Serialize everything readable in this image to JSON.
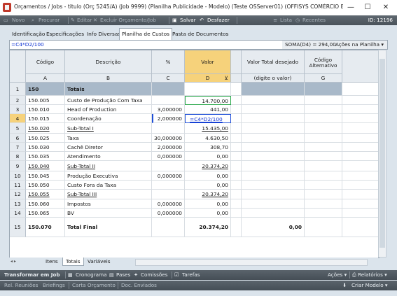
{
  "window": {
    "title": "Orçamentos / Jobs - titulo (Orç 5245/A) (Job 9999) (Planilha Publicidade - Modelo) (Teste OSServer01) (OFFISYS COMÉRCIO E SERVIÇO...",
    "minimize": "—",
    "maximize": "☐",
    "close": "✕"
  },
  "toolbar": {
    "novo": "Novo",
    "procurar": "Procurar",
    "editar": "Editar",
    "excluir": "Excluir Orçamento/Job",
    "salvar": "Salvar",
    "desfazer": "Desfazer",
    "lista": "Lista",
    "recentes": "Recentes",
    "id": "ID: 12196"
  },
  "tabs": [
    "Identificação",
    "Especificações",
    "Info Diversas",
    "Planilha de Custos",
    "Pasta de Documentos"
  ],
  "active_tab": 3,
  "formula_bar": {
    "formula": "=C4*D2/100",
    "sum": "SOMA(D4) = 294,00",
    "actions": "Ações na Planilha"
  },
  "columns": {
    "headers": [
      "Código",
      "Descrição",
      "%",
      "Valor",
      "Valor Total desejado",
      "Código Alternativo"
    ],
    "letters": [
      "A",
      "B",
      "C",
      "D",
      "(digite o valor)",
      "G"
    ]
  },
  "rows": [
    {
      "n": "1",
      "code": "150",
      "desc": "Totais",
      "pct": "",
      "valor": "",
      "total": "",
      "style": "band"
    },
    {
      "n": "2",
      "code": "150.005",
      "desc": "Custo de Produção Com Taxa",
      "pct": "",
      "valor": "14.700,00",
      "total": "",
      "style": ""
    },
    {
      "n": "3",
      "code": "150.010",
      "desc": "Head of Production",
      "pct": "3,000000",
      "valor": "441,00",
      "total": "",
      "style": ""
    },
    {
      "n": "4",
      "code": "150.015",
      "desc": "Coordenação",
      "pct": "2,000000",
      "valor": "=C4*D2/100",
      "total": "",
      "style": "edit"
    },
    {
      "n": "5",
      "code": "150.020",
      "desc": "Sub-Total I",
      "pct": "",
      "valor": "15.435,00",
      "total": "",
      "style": "sub"
    },
    {
      "n": "6",
      "code": "150.025",
      "desc": "Taxa",
      "pct": "30,000000",
      "valor": "4.630,50",
      "total": "",
      "style": ""
    },
    {
      "n": "7",
      "code": "150.030",
      "desc": "Cachê Diretor",
      "pct": "2,000000",
      "valor": "308,70",
      "total": "",
      "style": ""
    },
    {
      "n": "8",
      "code": "150.035",
      "desc": "Atendimento",
      "pct": "0,000000",
      "valor": "0,00",
      "total": "",
      "style": ""
    },
    {
      "n": "9",
      "code": "150.040",
      "desc": "Sub-Total II",
      "pct": "",
      "valor": "20.374,20",
      "total": "",
      "style": "sub"
    },
    {
      "n": "10",
      "code": "150.045",
      "desc": "Produção Executiva",
      "pct": "0,000000",
      "valor": "0,00",
      "total": "",
      "style": ""
    },
    {
      "n": "11",
      "code": "150.050",
      "desc": "Custo Fora da Taxa",
      "pct": "",
      "valor": "0,00",
      "total": "",
      "style": ""
    },
    {
      "n": "12",
      "code": "150.055",
      "desc": "Sub-Total III",
      "pct": "",
      "valor": "20.374,20",
      "total": "",
      "style": "sub"
    },
    {
      "n": "13",
      "code": "150.060",
      "desc": "Impostos",
      "pct": "0,000000",
      "valor": "0,00",
      "total": "",
      "style": ""
    },
    {
      "n": "14",
      "code": "150.065",
      "desc": "BV",
      "pct": "0,000000",
      "valor": "0,00",
      "total": "",
      "style": ""
    },
    {
      "n": "15",
      "code": "150.070",
      "desc": "Total Final",
      "pct": "",
      "valor": "20.374,20",
      "total": "0,00",
      "style": "final"
    }
  ],
  "sheet_tabs": [
    "Itens",
    "Totais",
    "Variáveis"
  ],
  "active_sheet": 1,
  "bottom_bar1": {
    "transformar": "Transformar em Job",
    "cronograma": "Cronograma",
    "pases": "Pases",
    "comissoes": "Comissões",
    "tarefas": "Tarefas",
    "acoes": "Ações",
    "relatorios": "Relatórios"
  },
  "bottom_bar2": {
    "rel_reunioes": "Rel. Reuniões",
    "briefings": "Briefings",
    "carta_orcamento": "Carta Orçamento",
    "doc_enviados": "Doc. Enviados",
    "criar_modelo": "Criar Modelo"
  },
  "icons": {
    "filter": "filter-icon",
    "dropdown": "chevron-down-icon"
  }
}
